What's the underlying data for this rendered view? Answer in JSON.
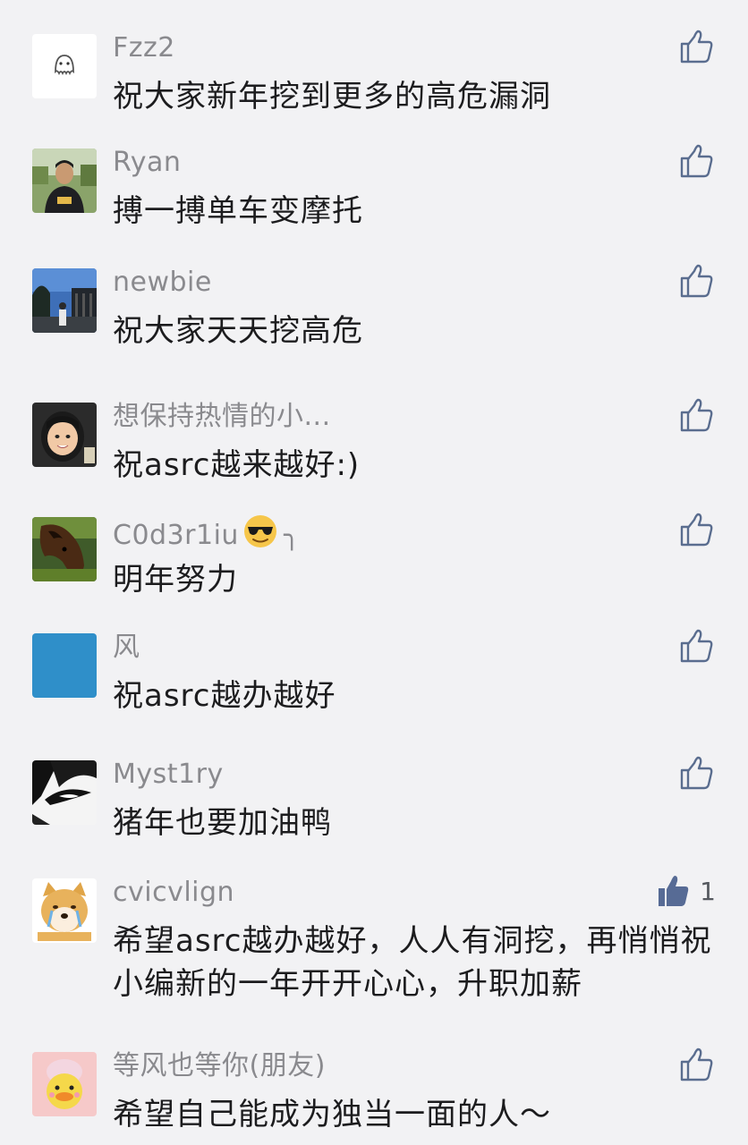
{
  "comments": [
    {
      "name": "Fzz2",
      "text": "祝大家新年挖到更多的高危漏洞",
      "liked": false,
      "like_count": "",
      "avatar": "ghost-avatar"
    },
    {
      "name": "Ryan",
      "text": "搏一搏单车变摩托",
      "liked": false,
      "like_count": "",
      "avatar": "person-photo-avatar"
    },
    {
      "name": "newbie",
      "text": "祝大家天天挖高危",
      "liked": false,
      "like_count": "",
      "avatar": "street-photo-avatar"
    },
    {
      "name": "想保持热情的小...",
      "text": "祝asrc越来越好:)",
      "liked": false,
      "like_count": "",
      "avatar": "child-photo-avatar"
    },
    {
      "name": "C0d3r1iu",
      "name_suffix": "╮",
      "text": "明年努力",
      "liked": false,
      "like_count": "",
      "avatar": "horse-avatar"
    },
    {
      "name": "风",
      "text": "祝asrc越办越好",
      "liked": false,
      "like_count": "",
      "avatar": "blue-square-avatar"
    },
    {
      "name": "Myst1ry",
      "text": "猪年也要加油鸭",
      "liked": false,
      "like_count": "",
      "avatar": "anime-eye-avatar"
    },
    {
      "name": "cvicvlign",
      "text": "希望asrc越办越好，人人有洞挖，再悄悄祝小编新的一年开开心心，升职加薪",
      "liked": true,
      "like_count": "1",
      "avatar": "shiba-doge-avatar"
    },
    {
      "name": "等风也等你(朋友)",
      "text": "希望自己能成为独当一面的人～",
      "liked": false,
      "like_count": "",
      "avatar": "yellow-duck-avatar"
    }
  ],
  "icons": {
    "like": "thumbs-up-outline-icon",
    "liked": "thumbs-up-filled-icon",
    "emoji": "sunglasses-face-emoji"
  },
  "colors": {
    "background": "#f2f2f4",
    "name": "#8a8a8e",
    "text": "#1c1c1e",
    "like_icon": "#5a6d8f",
    "liked_icon": "#576b95"
  }
}
